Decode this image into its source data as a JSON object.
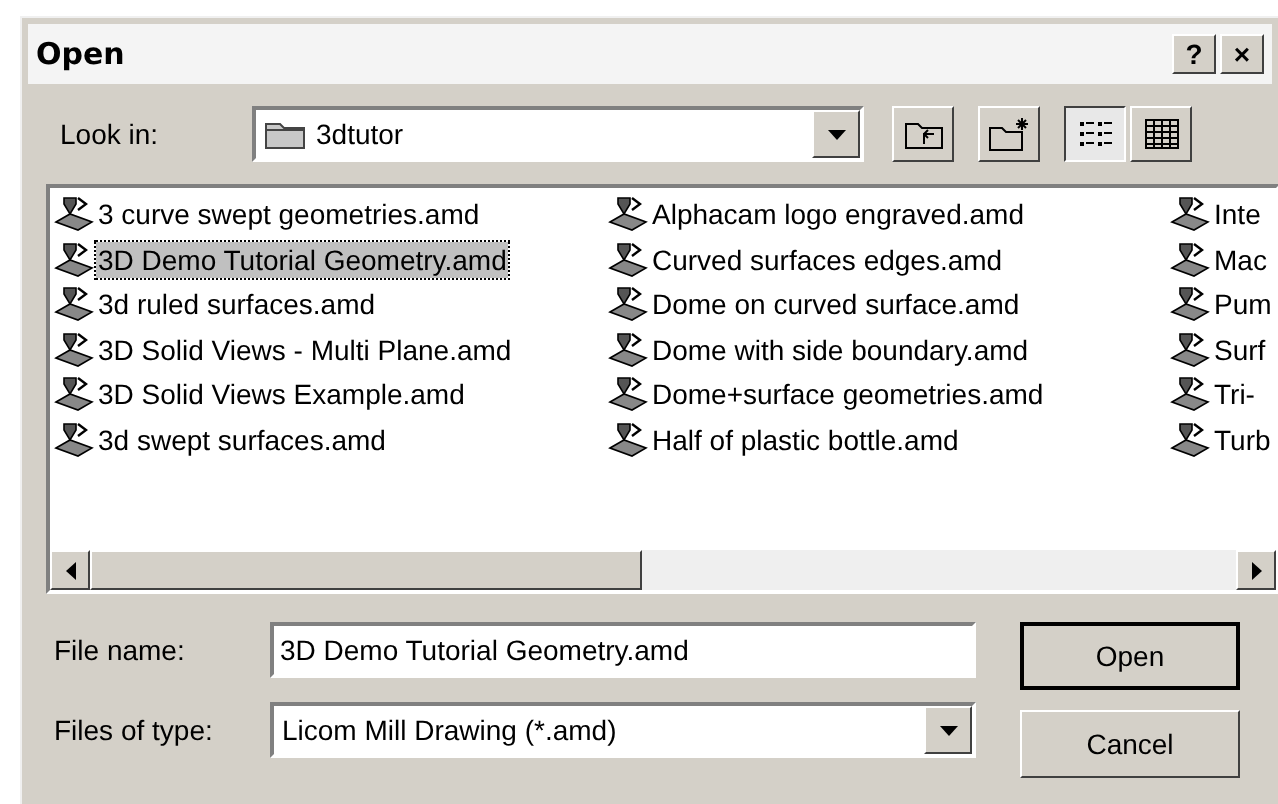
{
  "window": {
    "title": "Open",
    "title_buttons": [
      "?",
      "×"
    ]
  },
  "look_in": {
    "label": "Look in:",
    "value": "3dtutor"
  },
  "toolbar": [
    {
      "kind": "up-folder",
      "selected": false
    },
    {
      "kind": "new-folder",
      "selected": false
    },
    {
      "kind": "list-view",
      "selected": true
    },
    {
      "kind": "details-view",
      "selected": false
    }
  ],
  "files": [
    {
      "name": "3 curve swept geometries.amd",
      "selected": false
    },
    {
      "name": "3D Demo Tutorial Geometry.amd",
      "selected": true
    },
    {
      "name": "3d ruled surfaces.amd",
      "selected": false
    },
    {
      "name": "3D Solid Views - Multi Plane.amd",
      "selected": false
    },
    {
      "name": "3D Solid Views Example.amd",
      "selected": false
    },
    {
      "name": "3d swept surfaces.amd",
      "selected": false
    },
    {
      "name": "Alphacam logo engraved.amd",
      "selected": false
    },
    {
      "name": "Curved surfaces edges.amd",
      "selected": false
    },
    {
      "name": "Dome on curved surface.amd",
      "selected": false
    },
    {
      "name": "Dome with side boundary.amd",
      "selected": false
    },
    {
      "name": "Dome+surface geometries.amd",
      "selected": false
    },
    {
      "name": "Half of plastic bottle.amd",
      "selected": false
    },
    {
      "name": "Inte",
      "selected": false
    },
    {
      "name": "Mac",
      "selected": false
    },
    {
      "name": "Pum",
      "selected": false
    },
    {
      "name": "Surf",
      "selected": false
    },
    {
      "name": "Tri-",
      "selected": false
    },
    {
      "name": "Turb",
      "selected": false
    }
  ],
  "file_name": {
    "label": "File name:",
    "value": "3D Demo Tutorial Geometry.amd"
  },
  "file_type": {
    "label": "Files of type:",
    "value": "Licom Mill Drawing (*.amd)"
  },
  "buttons": [
    {
      "label": "Open",
      "default": true
    },
    {
      "label": "Cancel",
      "default": false
    }
  ]
}
